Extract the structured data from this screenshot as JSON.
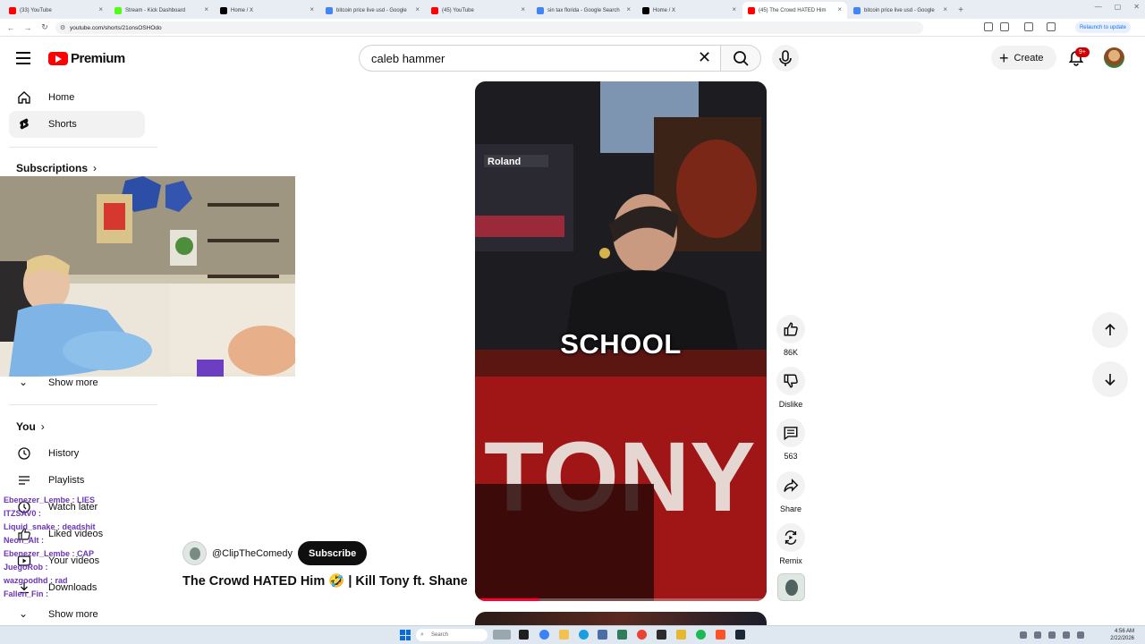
{
  "browser": {
    "tabs": [
      {
        "title": "(33) YouTube",
        "favicon_color": "#ff0000",
        "active": false
      },
      {
        "title": "Stream - Kick Dashboard",
        "favicon_color": "#53fc18",
        "active": false
      },
      {
        "title": "Home / X",
        "favicon_color": "#000000",
        "active": false
      },
      {
        "title": "bitcoin price live usd - Google",
        "favicon_color": "#4285f4",
        "active": false
      },
      {
        "title": "(45) YouTube",
        "favicon_color": "#ff0000",
        "active": false
      },
      {
        "title": "sin tax florida - Google Search",
        "favicon_color": "#4285f4",
        "active": false
      },
      {
        "title": "Home / X",
        "favicon_color": "#000000",
        "active": false
      },
      {
        "title": "(45) The Crowd HATED Him",
        "favicon_color": "#ff0000",
        "active": true
      },
      {
        "title": "bitcoin price live usd - Google",
        "favicon_color": "#4285f4",
        "active": false
      }
    ],
    "url": "youtube.com/shorts/21onsOSHOdo",
    "relaunch_label": "Relaunch to update"
  },
  "header": {
    "logo_text": "Premium",
    "search_value": "caleb hammer",
    "create_label": "Create",
    "notification_count": "9+"
  },
  "sidebar": {
    "home": "Home",
    "shorts": "Shorts",
    "subscriptions": "Subscriptions",
    "show_more": "Show more",
    "you": "You",
    "history": "History",
    "playlists": "Playlists",
    "watch_later": "Watch later",
    "liked_videos": "Liked videos",
    "your_videos": "Your videos",
    "downloads": "Downloads",
    "show_more_2": "Show more"
  },
  "chat_overlay": [
    "Ebenezer_Lembe : LIES",
    "ITZSAV0 : ",
    "Liquid_snake : deadshit",
    "Neon_Alt : ",
    "Ebenezer_Lembe : CAP",
    "JuegoRob : ",
    "wazgoodhd : rad",
    "Fallen_Fin : "
  ],
  "short": {
    "caption": "SCHOOL",
    "progress": 0.22,
    "channel": "@ClipTheComedy",
    "subscribe_label": "Subscribe",
    "title": "The Crowd HATED Him 🤣 | Kill Tony ft. Shane Gillis"
  },
  "actions": {
    "likes": "86K",
    "dislike": "Dislike",
    "comments": "563",
    "share": "Share",
    "remix": "Remix"
  },
  "taskbar": {
    "search_placeholder": "Search",
    "time": "4:56 AM",
    "date": "2/22/2026"
  },
  "colors": {
    "brand_red": "#ff0000",
    "accent_black": "#0f0f0f",
    "chip_bg": "#f2f2f2"
  }
}
